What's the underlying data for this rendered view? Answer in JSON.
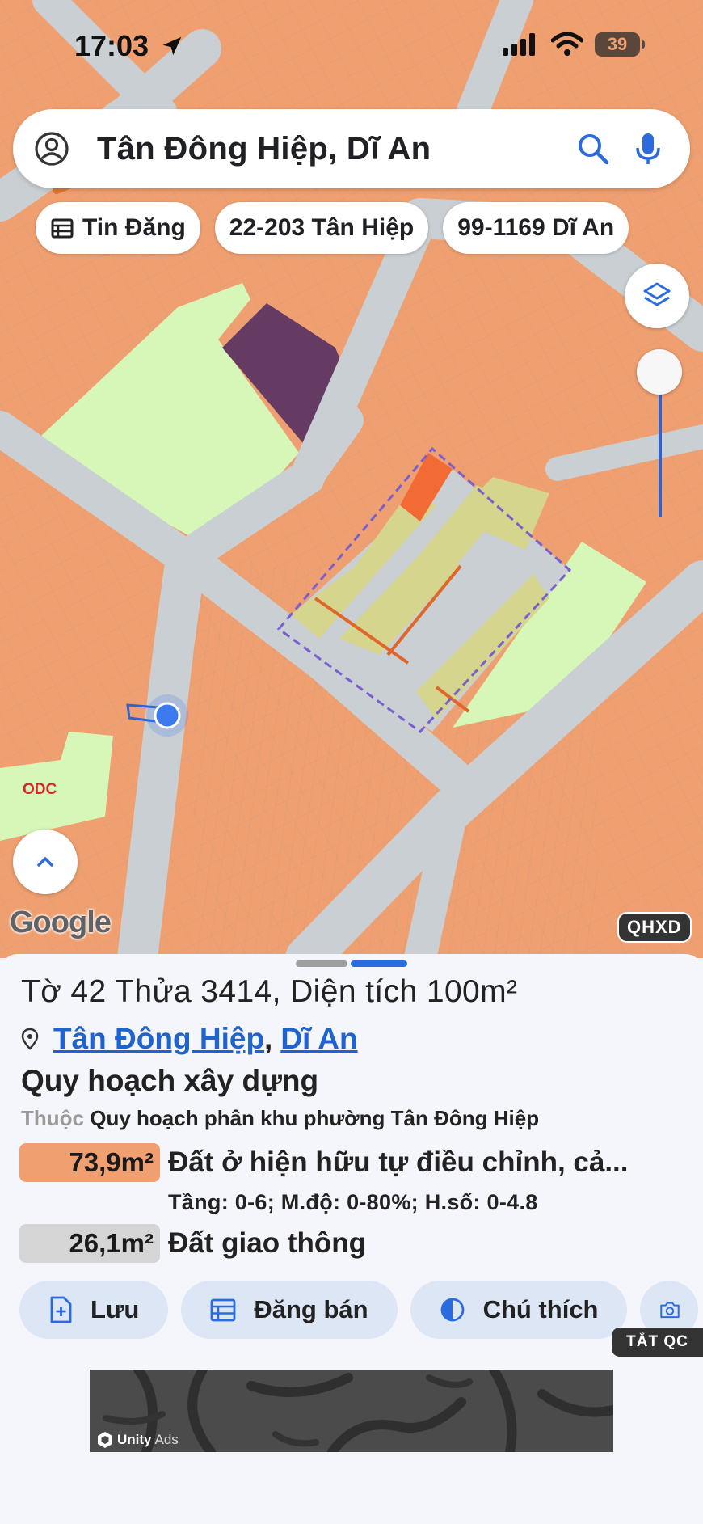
{
  "status_bar": {
    "time": "17:03",
    "battery": "39"
  },
  "search": {
    "query": "Tân Đông Hiệp, Dĩ An"
  },
  "chips": [
    {
      "label": "Tin Đăng",
      "icon": "calendar-icon"
    },
    {
      "label": "22-203 Tân Hiệp"
    },
    {
      "label": "99-1169 Dĩ An"
    }
  ],
  "map": {
    "odc_label": "ODC",
    "provider": "Google",
    "layer_badge": "QHXD",
    "colors": {
      "residential": "#f0a070",
      "road": "#c9cfd2",
      "green": "#d6f7b8",
      "purple": "#663b63",
      "plot": "#d5d58e",
      "accent": "#f26b35",
      "boundary": "#7a5fd0"
    }
  },
  "sheet": {
    "title": "Tờ 42 Thửa 3414, Diện tích 100m²",
    "location": {
      "ward": "Tân Đông Hiệp",
      "separator": ",",
      "city": "Dĩ An"
    },
    "plan_heading": "Quy hoạch xây dựng",
    "plan_prefix": "Thuộc",
    "plan_name": "Quy hoạch phân khu phường Tân Đông Hiệp",
    "zones": [
      {
        "area": "73,9m²",
        "name": "Đất ở hiện hữu tự điều chỉnh, cả...",
        "color": "#f0a070",
        "detail": "Tầng: 0-6; M.độ: 0-80%; H.số: 0-4.8"
      },
      {
        "area": "26,1m²",
        "name": "Đất giao thông",
        "color": "#d5d5d5"
      }
    ],
    "actions": [
      {
        "label": "Lưu",
        "icon": "save-file-icon"
      },
      {
        "label": "Đăng bán",
        "icon": "calendar-icon"
      },
      {
        "label": "Chú thích",
        "icon": "contrast-icon"
      },
      {
        "label": "",
        "icon": "camera-add-icon"
      }
    ],
    "ad": {
      "close_label": "TẮT QC",
      "brand": "Unity",
      "suffix": "Ads"
    }
  }
}
